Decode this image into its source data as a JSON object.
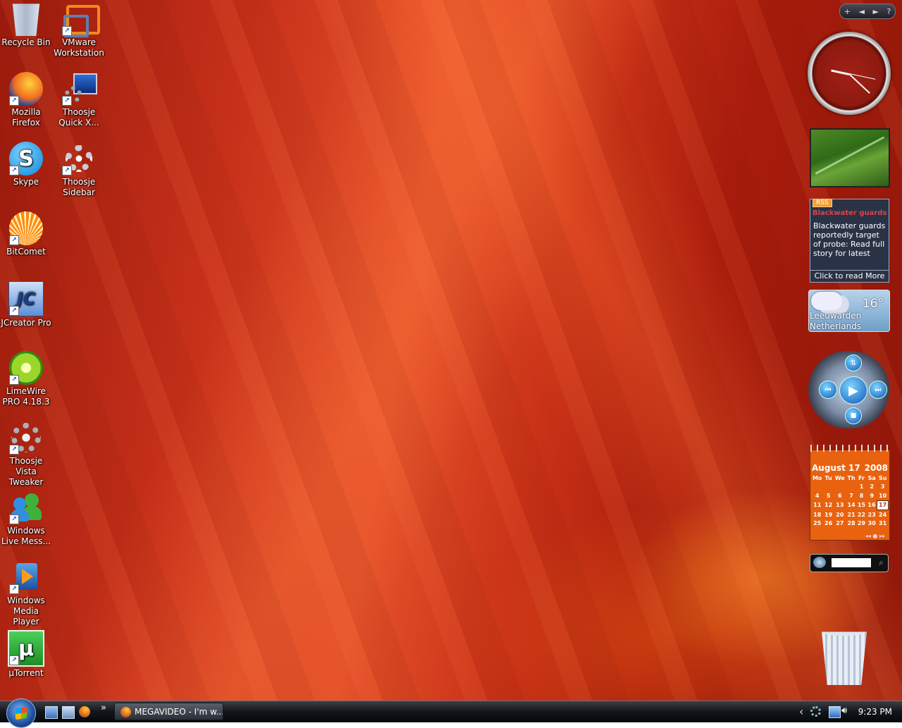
{
  "desktop_icons": [
    {
      "label": "Recycle Bin",
      "icon": "recycle-bin-icon"
    },
    {
      "label": "VMware Workstation",
      "icon": "vmware-icon"
    },
    {
      "label": "Mozilla Firefox",
      "icon": "firefox-icon"
    },
    {
      "label": "Thoosje Quick X...",
      "icon": "monitor-gear-icon"
    },
    {
      "label": "Skype",
      "icon": "skype-icon"
    },
    {
      "label": "Thoosje Sidebar",
      "icon": "gear-icon"
    },
    {
      "label": "BitComet",
      "icon": "bitcomet-icon"
    },
    {
      "label": "JCreator Pro",
      "icon": "jcreator-icon"
    },
    {
      "label": "LimeWire PRO 4.18.3",
      "icon": "limewire-icon"
    },
    {
      "label": "Thoosje Vista Tweaker",
      "icon": "gear-icon"
    },
    {
      "label": "Windows Live Mess...",
      "icon": "messenger-icon"
    },
    {
      "label": "Windows Media Player",
      "icon": "media-player-icon"
    },
    {
      "label": "µTorrent",
      "icon": "utorrent-icon"
    }
  ],
  "sidebar": {
    "controls": {
      "add": "+",
      "prev": "◄",
      "next": "►",
      "help": "?"
    },
    "rss": {
      "tag": "RSS",
      "headline": "Blackwater guards",
      "body": "Blackwater guards reportedly target of probe: Read full story for latest",
      "more": "Click to read More"
    },
    "weather": {
      "temperature": "16°",
      "city": "Leeuwarden",
      "country": "Netherlands"
    },
    "calendar": {
      "month_day": "August 17",
      "year": "2008",
      "weekdays": [
        "Mo",
        "Tu",
        "We",
        "Th",
        "Fr",
        "Sa",
        "Su"
      ],
      "weeks": [
        [
          "",
          "",
          "",
          "",
          "1",
          "2",
          "3"
        ],
        [
          "4",
          "5",
          "6",
          "7",
          "8",
          "9",
          "10"
        ],
        [
          "11",
          "12",
          "13",
          "14",
          "15",
          "16",
          "17"
        ],
        [
          "18",
          "19",
          "20",
          "21",
          "22",
          "23",
          "24"
        ],
        [
          "25",
          "26",
          "27",
          "28",
          "29",
          "30",
          "31"
        ]
      ],
      "today": "17"
    }
  },
  "taskbar": {
    "active_window": "MEGAVIDEO - I'm w...",
    "overflow_chevron": "»",
    "tray_chevron": "‹",
    "time": "9:23 PM"
  }
}
